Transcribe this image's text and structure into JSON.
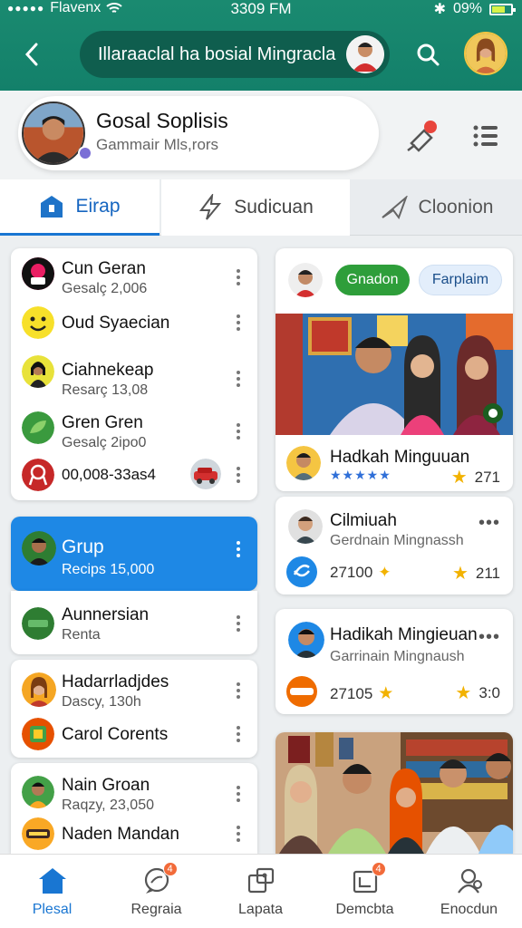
{
  "status_bar": {
    "carrier": "Flavenx",
    "time": "3309 FM",
    "battery": "09%"
  },
  "header": {
    "search_text": "Illaraaclal ha bosial Mingracla"
  },
  "profile": {
    "name": "Gosal Soplisis",
    "subtitle": "Gammair Mls,rors"
  },
  "tabs": [
    {
      "label": "Eirap",
      "active": true
    },
    {
      "label": "Sudicuan",
      "active": false
    },
    {
      "label": "Cloonion",
      "active": false
    }
  ],
  "left_lists": {
    "card1": [
      {
        "title": "Cun Geran",
        "subtitle": "Gesalç 2,006"
      },
      {
        "title": "Oud Syaecian",
        "subtitle": ""
      },
      {
        "title": "Ciahnekeap",
        "subtitle": "Resarç 13,08"
      },
      {
        "title": "Gren Gren",
        "subtitle": "Gesalç 2ipo0"
      },
      {
        "title": "00,008-33as4",
        "subtitle": ""
      }
    ],
    "group": {
      "title": "Grup",
      "subtitle": "Recips 15,000"
    },
    "card2": [
      {
        "title": "Aunnersian",
        "subtitle": "Renta"
      }
    ],
    "card3": [
      {
        "title": "Hadarrladjdes",
        "subtitle": "Dascy, 130h"
      },
      {
        "title": "Carol Corents",
        "subtitle": ""
      }
    ],
    "card4": [
      {
        "title": "Nain Groan",
        "subtitle": "Raqzy, 23,050"
      },
      {
        "title": "Naden Mandan",
        "subtitle": ""
      }
    ]
  },
  "right_feed": {
    "pills": {
      "green": "Gnadon",
      "blue": "Farplaim"
    },
    "post1": {
      "title": "Hadkah Minguuan",
      "stars": "★★★★★",
      "rating": "271"
    },
    "post2": {
      "title": "Cilmiuah",
      "subtitle": "Gerdnain Mingnassh",
      "value": "27100",
      "rating": "211"
    },
    "post3": {
      "title": "Hadikah Mingieuan",
      "subtitle": "Garrinain Mingnaush",
      "value": "27105",
      "rating": "3:0"
    }
  },
  "bottom_nav": [
    {
      "label": "Plesal",
      "active": true,
      "badge": ""
    },
    {
      "label": "Regraia",
      "active": false,
      "badge": "4"
    },
    {
      "label": "Lapata",
      "active": false,
      "badge": ""
    },
    {
      "label": "Demcbta",
      "active": false,
      "badge": "4"
    },
    {
      "label": "Enocdun",
      "active": false,
      "badge": ""
    }
  ],
  "colors": {
    "header": "#13806a",
    "accent": "#1976d2",
    "group_card": "#1e88e5",
    "green_pill": "#2e9e3a",
    "star": "#f2b200"
  }
}
